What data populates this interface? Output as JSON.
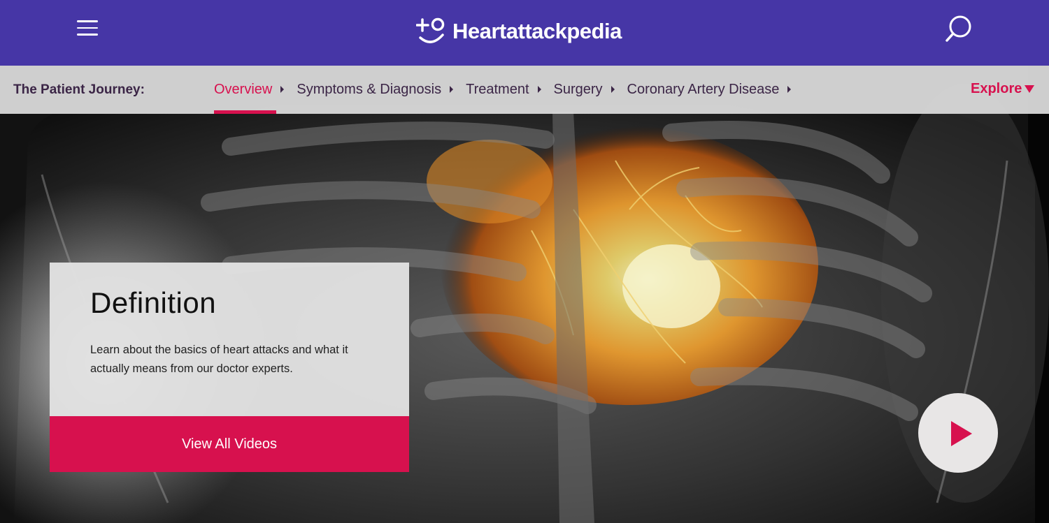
{
  "header": {
    "brand_name": "Heartattackpedia",
    "menu_icon": "hamburger-menu-icon",
    "search_icon": "search-icon",
    "background_color": "#4636a6"
  },
  "journey": {
    "label": "The Patient Journey:",
    "tabs": [
      {
        "label": "Overview",
        "active": true
      },
      {
        "label": "Symptoms & Diagnosis",
        "active": false
      },
      {
        "label": "Treatment",
        "active": false
      },
      {
        "label": "Surgery",
        "active": false
      },
      {
        "label": "Coronary Artery Disease",
        "active": false
      }
    ],
    "explore_label": "Explore",
    "accent_color": "#d7114e"
  },
  "card": {
    "title": "Definition",
    "description": "Learn about the basics of heart attacks and what it actually means from our doctor experts.",
    "cta_label": "View All Videos"
  },
  "hero": {
    "play_icon": "play-icon"
  }
}
